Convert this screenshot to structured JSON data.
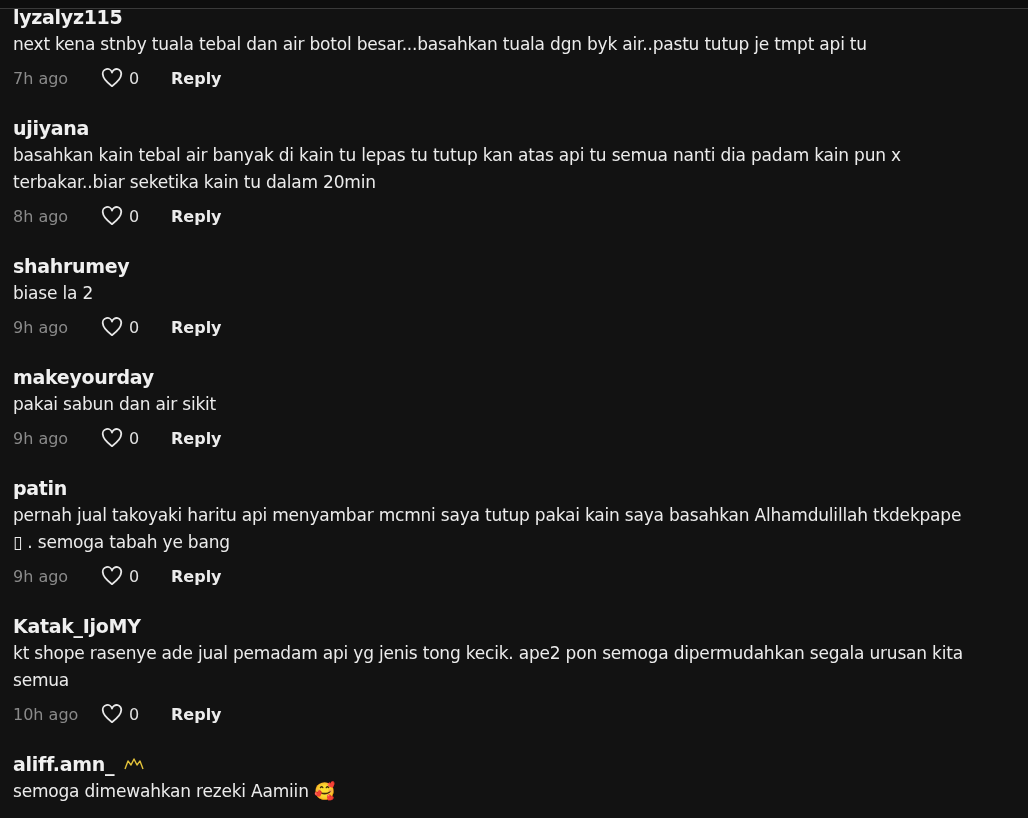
{
  "comments": [
    {
      "user": "lyzalyz115",
      "text": "next kena stnby tuala tebal dan air botol besar...basahkan tuala dgn byk air..pastu tutup je tmpt api tu",
      "time": "7h ago",
      "likes": "0",
      "reply": "Reply"
    },
    {
      "user": "ujiyana",
      "text": "basahkan kain tebal air banyak di kain tu lepas tu tutup kan atas api tu semua nanti dia padam kain pun x terbakar..biar seketika kain tu dalam 20min",
      "time": "8h ago",
      "likes": "0",
      "reply": "Reply"
    },
    {
      "user": "shahrumey",
      "text": "biase la 2",
      "time": "9h ago",
      "likes": "0",
      "reply": "Reply"
    },
    {
      "user": "makeyourday",
      "text": "pakai sabun dan air sikit",
      "time": "9h ago",
      "likes": "0",
      "reply": "Reply"
    },
    {
      "user": "patin",
      "text": "pernah jual takoyaki haritu api menyambar mcmni saya tutup pakai kain saya basahkan Alhamdulillah tkdekpape ▯ . semoga tabah ye bang",
      "time": "9h ago",
      "likes": "0",
      "reply": "Reply"
    },
    {
      "user": "Katak_IjoMY",
      "text": "kt shope rasenye ade jual pemadam api yg jenis tong kecik. ape2 pon semoga dipermudahkan segala urusan kita semua",
      "time": "10h ago",
      "likes": "0",
      "reply": "Reply"
    },
    {
      "user": "aliff.amn_",
      "badge": true,
      "text": "semoga dimewahkan rezeki Aamiin 🥰"
    }
  ]
}
